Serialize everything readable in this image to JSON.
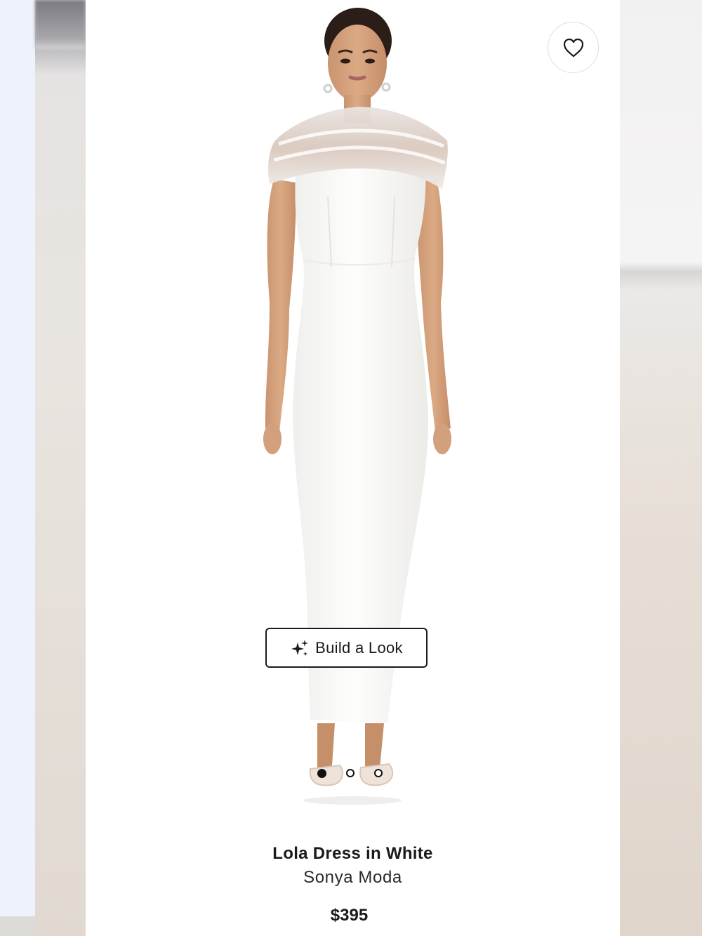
{
  "product": {
    "name": "Lola Dress in White",
    "brand": "Sonya Moda",
    "price": "$395"
  },
  "actions": {
    "build_look_label": "Build a Look",
    "wishlist_icon": "heart-outline-icon",
    "build_look_icon": "sparkles-icon"
  },
  "carousel": {
    "total_images": 3,
    "active_index": 0
  },
  "colors": {
    "text": "#1a1a1a",
    "card_background": "#ffffff",
    "button_border": "#1a1a1a"
  }
}
